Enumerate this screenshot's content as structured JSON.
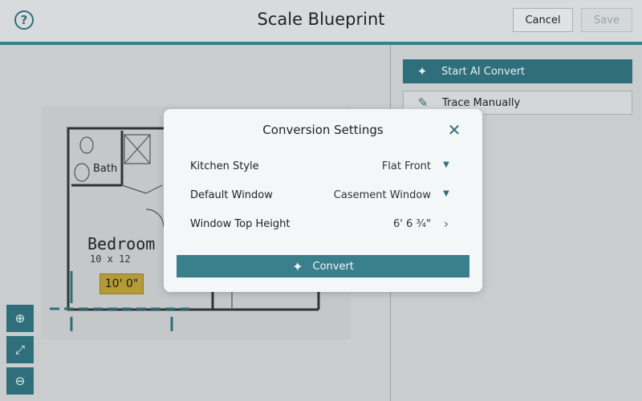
{
  "header": {
    "help_icon": "question-circle-icon",
    "title": "Scale Blueprint",
    "cancel_label": "Cancel",
    "save_label": "Save"
  },
  "colors": {
    "accent": "#3a7f8c",
    "dark_teal": "#2f6f7c",
    "measure_badge": "#b59a37"
  },
  "blueprint": {
    "bath_label": "Bath",
    "room_name": "Bedroom",
    "room_size": "10 x 12",
    "measurement": "10' 0\""
  },
  "zoom_controls": [
    {
      "icon": "zoom-in-icon"
    },
    {
      "icon": "fit-screen-icon"
    },
    {
      "icon": "zoom-out-icon"
    }
  ],
  "side_panel": {
    "start_ai_label": "Start AI Convert",
    "start_ai_icon": "magic-wand-icon",
    "trace_label": "Trace Manually",
    "trace_icon": "pencil-icon"
  },
  "modal": {
    "title": "Conversion Settings",
    "rows": [
      {
        "label": "Kitchen Style",
        "value": "Flat Front",
        "control": "dropdown"
      },
      {
        "label": "Default Window",
        "value": "Casement Window",
        "control": "dropdown"
      },
      {
        "label": "Window Top Height",
        "value": "6' 6 ¾\"",
        "control": "chevron"
      }
    ],
    "convert_label": "Convert",
    "convert_icon": "sparkle-icon"
  }
}
